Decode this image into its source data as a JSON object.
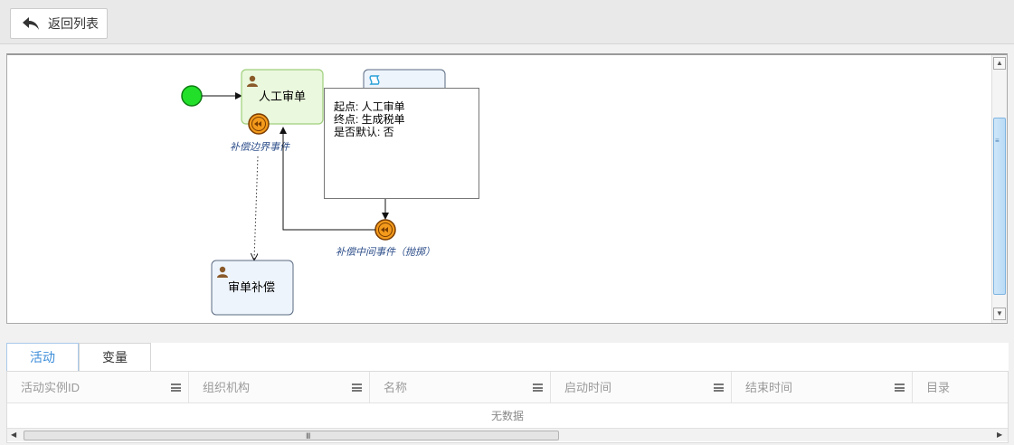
{
  "toolbar": {
    "back_label": "返回列表"
  },
  "diagram": {
    "task_review": "人工审单",
    "task_compensate": "审单补偿",
    "boundary_event_label": "补偿边界事件",
    "intermediate_event_label": "补偿中间事件（抛掷）",
    "popup": {
      "line1": "起点: 人工审单",
      "line2": "终点: 生成税单",
      "line3": "是否默认: 否"
    },
    "colors": {
      "start_event": "#22e02a",
      "user_task_fill": "#eaf8dd",
      "user_task_border": "#9fcf7c",
      "compensate_task_fill": "#eef4fc",
      "compensate_event": "#f39a1c",
      "label_color": "#2d4e8a"
    }
  },
  "tabs": [
    {
      "label": "活动",
      "active": true
    },
    {
      "label": "变量",
      "active": false
    }
  ],
  "grid": {
    "columns": [
      "活动实例ID",
      "组织机构",
      "名称",
      "启动时间",
      "结束时间",
      "目录"
    ],
    "empty_text": "无数据"
  },
  "scroll_glyphs": {
    "h_grip": "III",
    "v_grip": "≡"
  }
}
